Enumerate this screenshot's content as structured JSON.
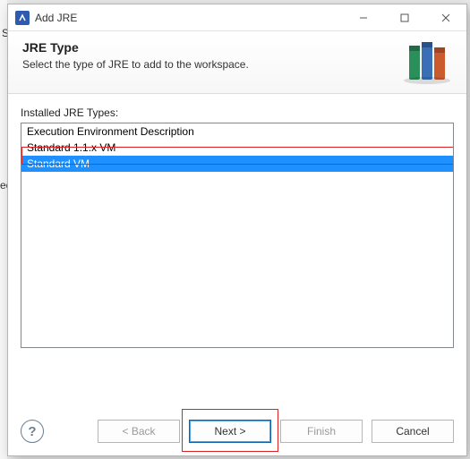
{
  "window": {
    "title": "Add JRE"
  },
  "header": {
    "title": "JRE Type",
    "subtitle": "Select the type of JRE to add to the workspace."
  },
  "list": {
    "label": "Installed JRE Types:",
    "items": [
      {
        "label": "Execution Environment Description",
        "selected": false
      },
      {
        "label": "Standard 1.1.x VM",
        "selected": false
      },
      {
        "label": "Standard VM",
        "selected": true
      }
    ]
  },
  "buttons": {
    "back": "< Back",
    "next": "Next >",
    "finish": "Finish",
    "cancel": "Cancel"
  },
  "bg": {
    "s": "S",
    "ec": "ec"
  }
}
